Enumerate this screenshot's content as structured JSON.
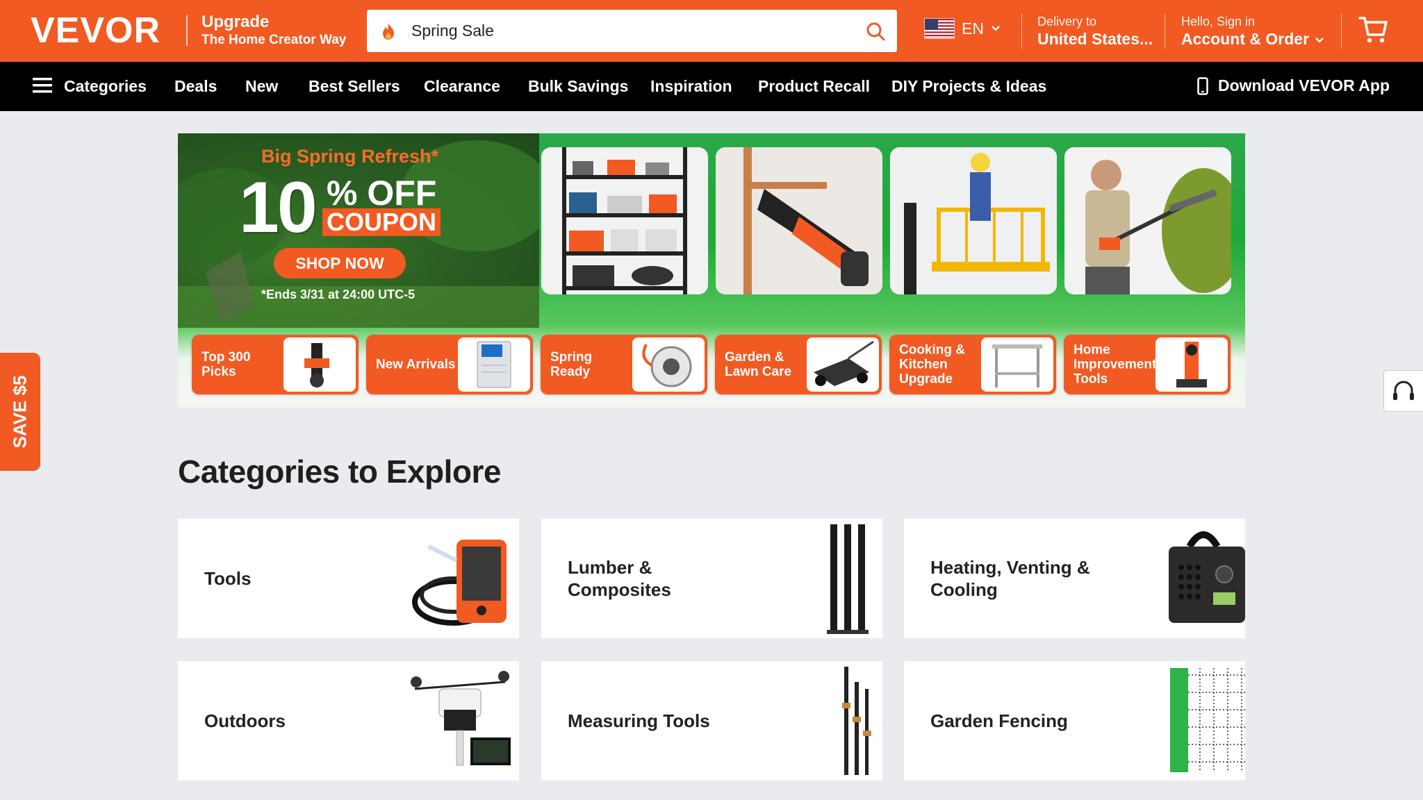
{
  "header": {
    "logo": "VEVOR",
    "tagline_line1": "Upgrade",
    "tagline_line2": "The Home Creator Way",
    "search_value": "Spring Sale",
    "language": "EN",
    "delivery_label": "Delivery to",
    "delivery_value": "United States...",
    "account_label": "Hello, Sign in",
    "account_value": "Account & Order",
    "icons": [
      "fire-icon",
      "search-icon",
      "us-flag-icon",
      "chevron-down-icon",
      "cart-icon"
    ]
  },
  "nav": {
    "categories": "Categories",
    "items": [
      "Deals",
      "New",
      "Best Sellers",
      "Clearance",
      "Bulk Savings",
      "Inspiration",
      "Product Recall",
      "DIY Projects & Ideas"
    ],
    "app_link": "Download VEVOR App"
  },
  "banner": {
    "kicker": "Big Spring Refresh*",
    "percent": "10",
    "off": "% OFF",
    "coupon": "COUPON",
    "cta": "SHOP NOW",
    "ends": "*Ends 3/31 at 24:00 UTC-5",
    "pills": [
      "Top 300 Picks",
      "New Arrivals",
      "Spring Ready",
      "Garden & Lawn Care",
      "Cooking & Kitchen Upgrade",
      "Home Improvement Tools"
    ]
  },
  "save_tab": "SAVE $5",
  "categories": {
    "heading": "Categories to Explore",
    "cards": [
      "Tools",
      "Lumber & Composites",
      "Heating, Venting & Cooling",
      "Outdoors",
      "Measuring Tools",
      "Garden Fencing"
    ]
  },
  "colors": {
    "brand_orange": "#f15a22",
    "nav_black": "#000000",
    "banner_green": "#1faa3a",
    "page_bg": "#e9ebee"
  }
}
